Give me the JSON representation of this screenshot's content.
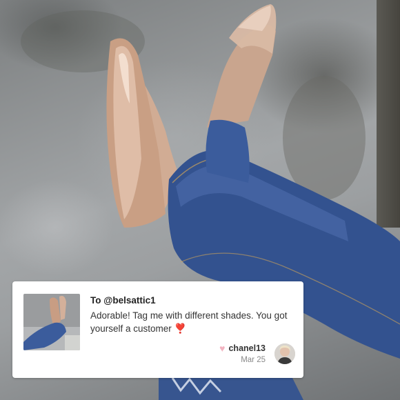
{
  "comment": {
    "recipient": "To @belsattic1",
    "text": "Adorable! Tag me with different shades. You got yourself a customer",
    "emoji": "❣️",
    "username": "chanel13",
    "date": "Mar 25"
  },
  "icons": {
    "like": "heart-icon",
    "emoji": "heart-exclamation-icon"
  },
  "colors": {
    "like_heart": "#f2b3c0",
    "emoji_heart": "#d32f3a"
  }
}
